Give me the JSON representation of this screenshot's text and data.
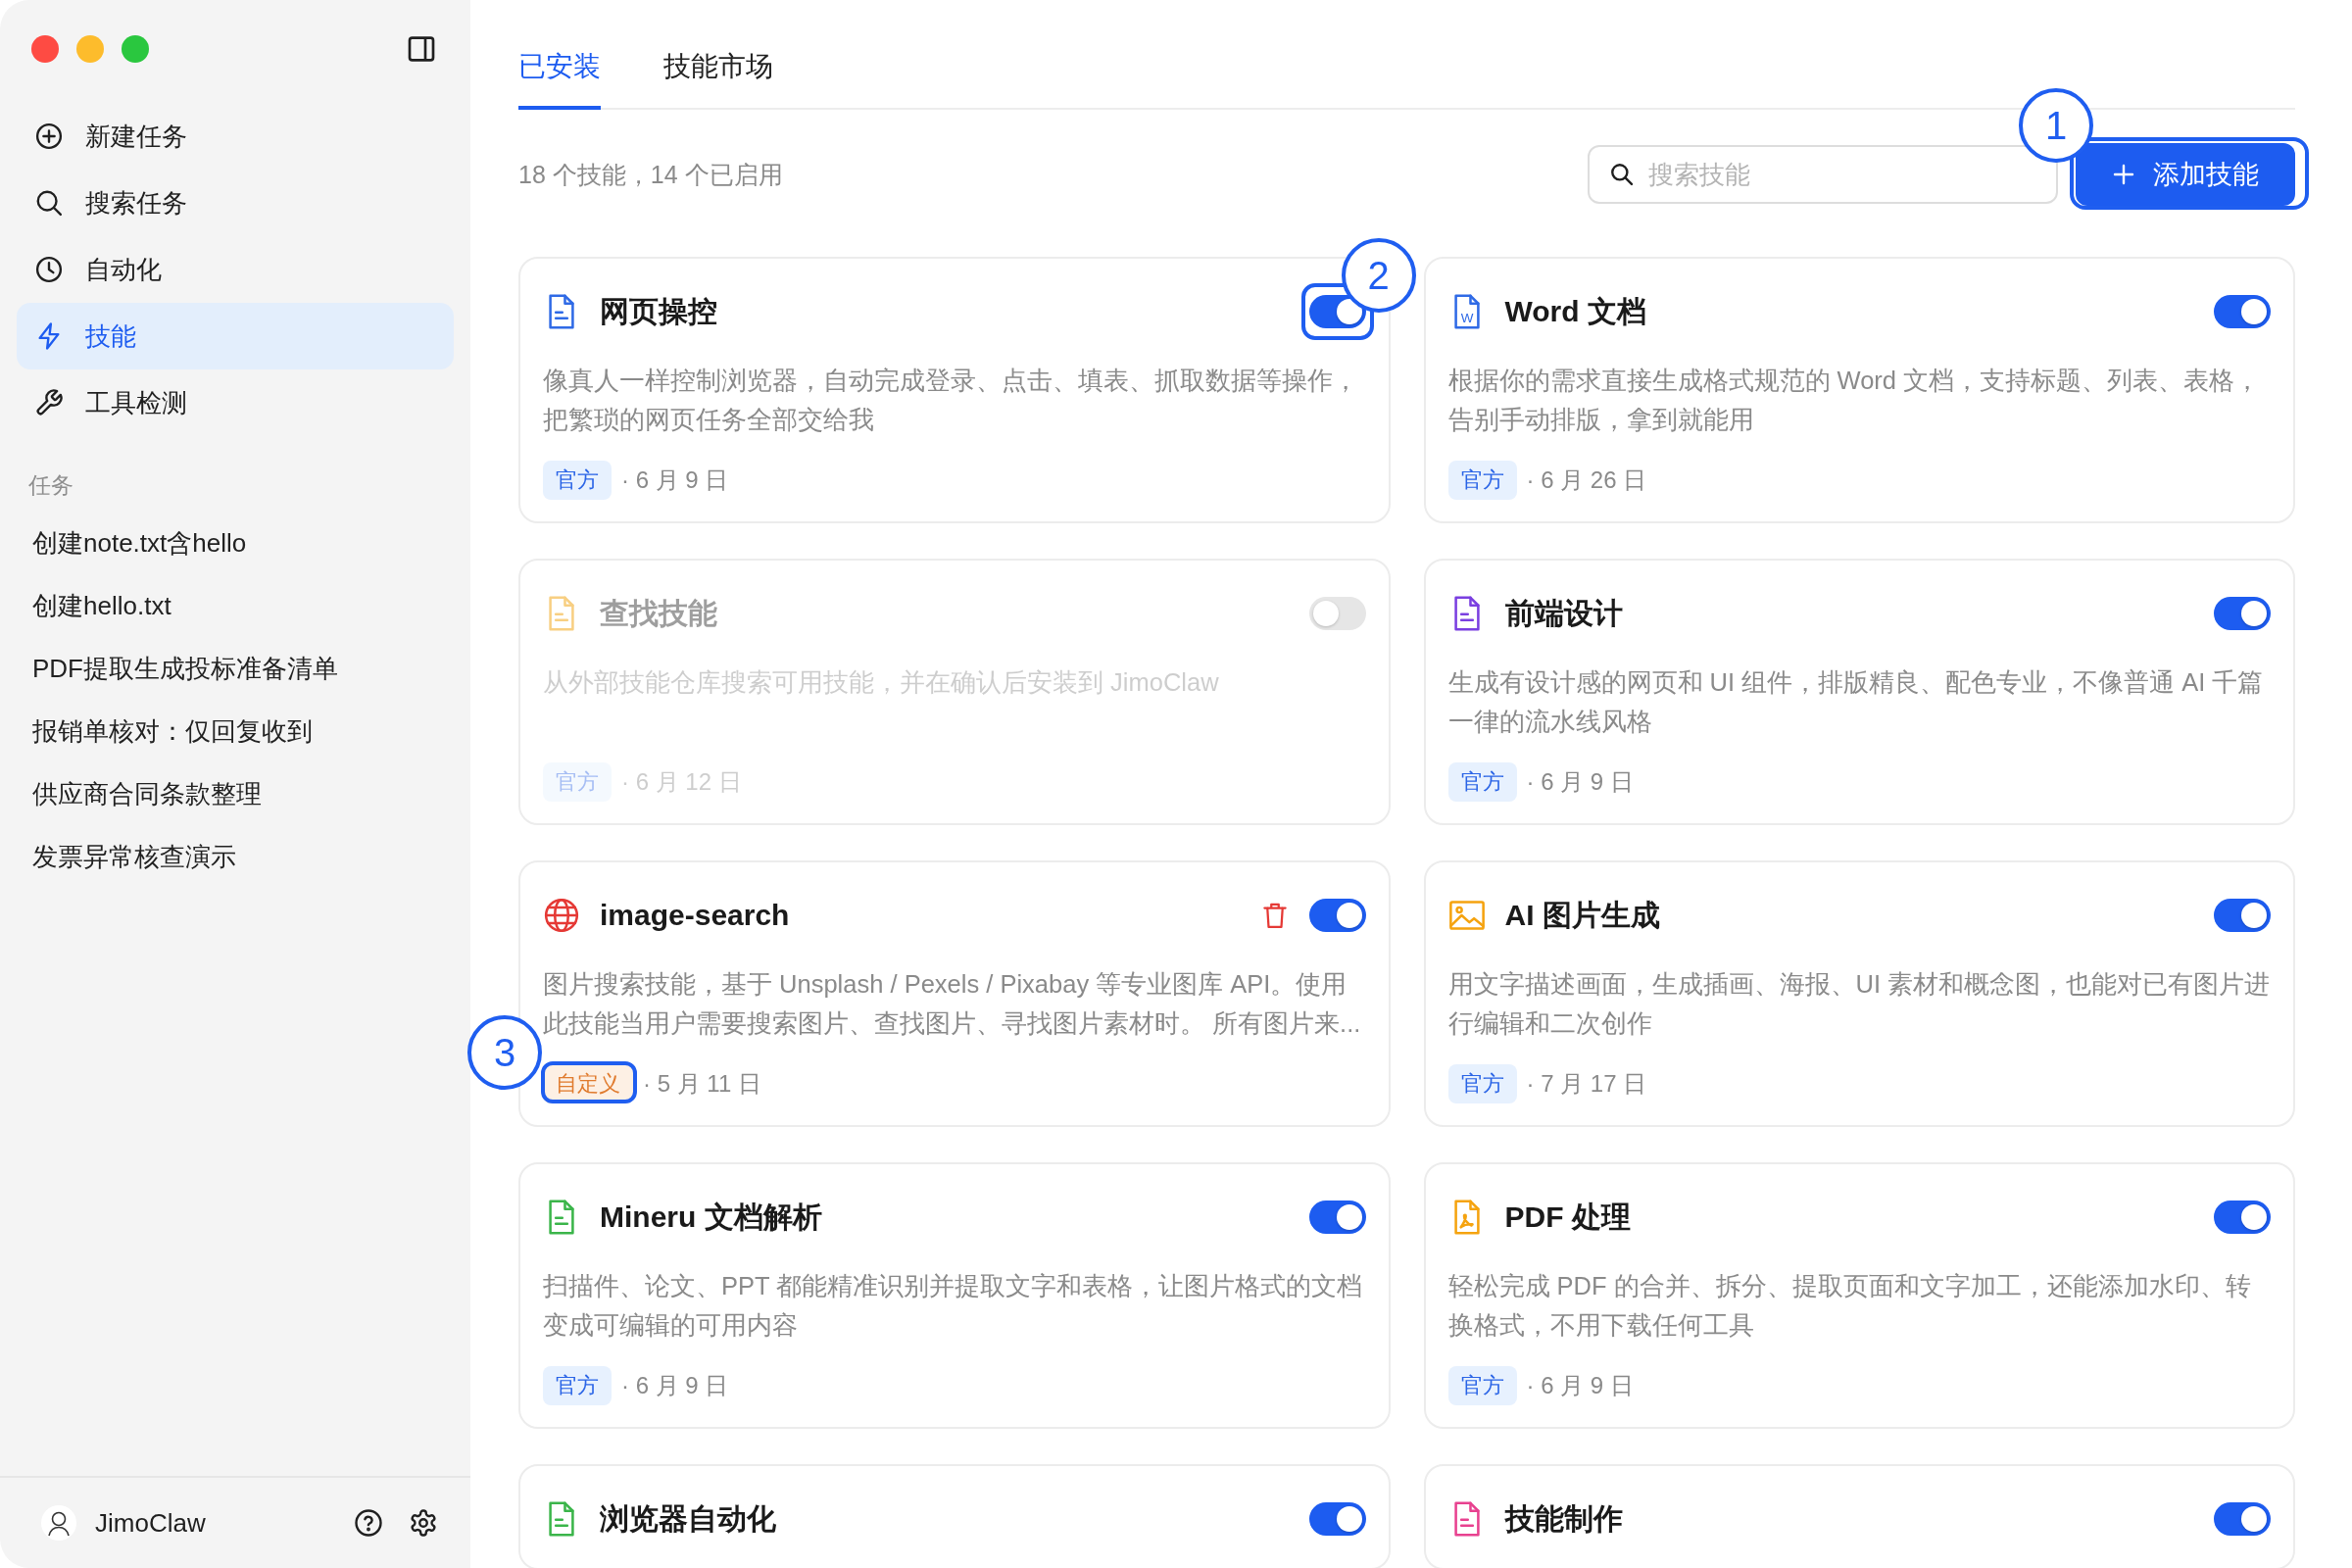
{
  "sidebar": {
    "nav": [
      {
        "label": "新建任务",
        "kind": "new_task",
        "selected": false
      },
      {
        "label": "搜索任务",
        "kind": "search",
        "selected": false
      },
      {
        "label": "自动化",
        "kind": "automation",
        "selected": false
      },
      {
        "label": "技能",
        "kind": "skills",
        "selected": true
      },
      {
        "label": "工具检测",
        "kind": "tools",
        "selected": false
      }
    ],
    "section_title": "任务",
    "tasks": [
      {
        "label": "创建note.txt含hello",
        "selected": false
      },
      {
        "label": "创建hello.txt",
        "selected": false
      },
      {
        "label": "PDF提取生成投标准备清单",
        "selected": false
      },
      {
        "label": "报销单核对：仅回复收到",
        "selected": false
      },
      {
        "label": "供应商合同条款整理",
        "selected": false
      },
      {
        "label": "发票异常核查演示",
        "selected": false
      }
    ],
    "user": {
      "name": "JimoClaw"
    }
  },
  "main": {
    "tabs": [
      {
        "label": "已安装",
        "selected": true
      },
      {
        "label": "技能市场",
        "selected": false
      }
    ],
    "summary": "18 个技能，14 个已启用",
    "search": {
      "placeholder": "搜索技能"
    },
    "add_button": {
      "label": "添加技能",
      "callout": "1"
    },
    "skills": [
      {
        "title": "网页操控",
        "kind": "doc",
        "color": "#2f6ae6",
        "enabled": true,
        "toggle_callout": "2",
        "deletable": false,
        "description": "像真人一样控制浏览器，自动完成登录、点击、填表、抓取数据等操作，把繁琐的网页任务全部交给我",
        "tag": {
          "label": "官方",
          "kind": "official"
        },
        "date": "· 6 月 9 日"
      },
      {
        "title": "Word 文档",
        "kind": "word",
        "icon_text": "W",
        "color": "#2f6ae6",
        "enabled": true,
        "deletable": false,
        "description": "根据你的需求直接生成格式规范的 Word 文档，支持标题、列表、表格，告别手动排版，拿到就能用",
        "tag": {
          "label": "官方",
          "kind": "official"
        },
        "date": "· 6 月 26 日"
      },
      {
        "title": "查找技能",
        "kind": "doc",
        "color": "#f8cf82",
        "enabled": false,
        "deletable": false,
        "description": "从外部技能仓库搜索可用技能，并在确认后安装到 JimoClaw",
        "tag": {
          "label": "官方",
          "kind": "official"
        },
        "date": "· 6 月 12 日"
      },
      {
        "title": "前端设计",
        "kind": "doc",
        "color": "#7a3fe0",
        "enabled": true,
        "deletable": false,
        "description": "生成有设计感的网页和 UI 组件，排版精良、配色专业，不像普通 AI 千篇一律的流水线风格",
        "tag": {
          "label": "官方",
          "kind": "official"
        },
        "date": "· 6 月 9 日"
      },
      {
        "title": "image-search",
        "kind": "globe",
        "color": "#e53935",
        "enabled": true,
        "deletable": true,
        "description": "图片搜索技能，基于 Unsplash / Pexels / Pixabay 等专业图库 API。使用此技能当用户需要搜索图片、查找图片、寻找图片素材时。 所有图片来...",
        "tag": {
          "label": "自定义",
          "kind": "custom",
          "callout": "3"
        },
        "date": "· 5 月 11 日"
      },
      {
        "title": "AI 图片生成",
        "kind": "image",
        "color": "#f5a30f",
        "enabled": true,
        "deletable": false,
        "description": "用文字描述画面，生成插画、海报、UI 素材和概念图，也能对已有图片进行编辑和二次创作",
        "tag": {
          "label": "官方",
          "kind": "official"
        },
        "date": "· 7 月 17 日"
      },
      {
        "title": "Mineru 文档解析",
        "kind": "doc",
        "color": "#3bb54a",
        "enabled": true,
        "deletable": false,
        "description": "扫描件、论文、PPT 都能精准识别并提取文字和表格，让图片格式的文档变成可编辑的可用内容",
        "tag": {
          "label": "官方",
          "kind": "official"
        },
        "date": "· 6 月 9 日"
      },
      {
        "title": "PDF 处理",
        "kind": "pdf",
        "color": "#f5a30f",
        "enabled": true,
        "deletable": false,
        "description": "轻松完成 PDF 的合并、拆分、提取页面和文字加工，还能添加水印、转换格式，不用下载任何工具",
        "tag": {
          "label": "官方",
          "kind": "official"
        },
        "date": "· 6 月 9 日"
      },
      {
        "title": "浏览器自动化",
        "kind": "doc",
        "color": "#3bb54a",
        "enabled": true,
        "deletable": false
      },
      {
        "title": "技能制作",
        "kind": "doc",
        "color": "#e8418f",
        "enabled": true,
        "deletable": false
      }
    ]
  }
}
